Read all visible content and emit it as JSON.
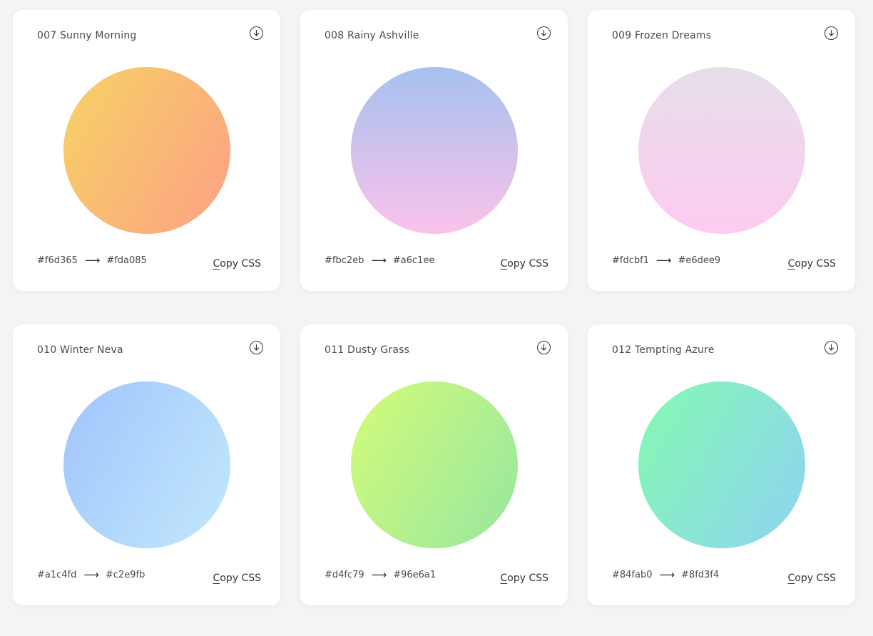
{
  "cards": [
    {
      "title": "007 Sunny Morning",
      "from": "#f6d365",
      "to": "#fda085",
      "direction": "120deg",
      "copy_label": "Copy CSS"
    },
    {
      "title": "008 Rainy Ashville",
      "from": "#fbc2eb",
      "to": "#a6c1ee",
      "direction": "0deg",
      "copy_label": "Copy CSS"
    },
    {
      "title": "009 Frozen Dreams",
      "from": "#fdcbf1",
      "to": "#e6dee9",
      "direction": "0deg",
      "copy_label": "Copy CSS"
    },
    {
      "title": "010 Winter Neva",
      "from": "#a1c4fd",
      "to": "#c2e9fb",
      "direction": "120deg",
      "copy_label": "Copy CSS"
    },
    {
      "title": "011 Dusty Grass",
      "from": "#d4fc79",
      "to": "#96e6a1",
      "direction": "120deg",
      "copy_label": "Copy CSS"
    },
    {
      "title": "012 Tempting Azure",
      "from": "#84fab0",
      "to": "#8fd3f4",
      "direction": "120deg",
      "copy_label": "Copy CSS"
    }
  ],
  "icons": {
    "download": "download-circle-icon",
    "arrow": "arrow-right-icon"
  },
  "arrow_glyph": "⟶"
}
